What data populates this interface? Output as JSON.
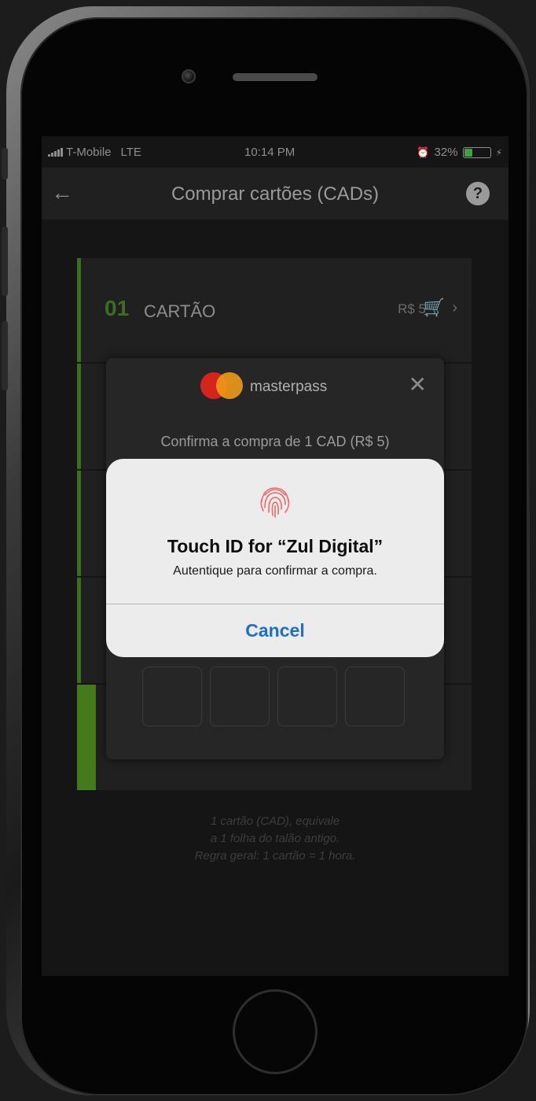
{
  "status_bar": {
    "carrier": "T-Mobile",
    "network": "LTE",
    "time": "10:14 PM",
    "battery": "32%",
    "battery_level": 0.32
  },
  "nav": {
    "title": "Comprar cartões (CADs)",
    "help": "?"
  },
  "cards": [
    {
      "number": "01",
      "label": "CARTÃO",
      "price": "R$ 5"
    }
  ],
  "masterpass": {
    "brand": "masterpass",
    "confirm_text": "Confirma a compra de 1 CAD (R$ 5)"
  },
  "touch_id": {
    "title": "Touch ID for “Zul Digital”",
    "message": "Autentique para confirmar a compra.",
    "cancel_label": "Cancel"
  },
  "footer": {
    "line1": "1 cartão (CAD), equivale",
    "line2": "a 1 folha do talão antigo.",
    "line3": "Regra geral: 1 cartão = 1 hora."
  },
  "colors": {
    "accent_green": "#3a6e1f",
    "cancel_blue": "#1b6ed4",
    "mc_red": "#d5241b",
    "mc_orange": "#f09a1a"
  }
}
